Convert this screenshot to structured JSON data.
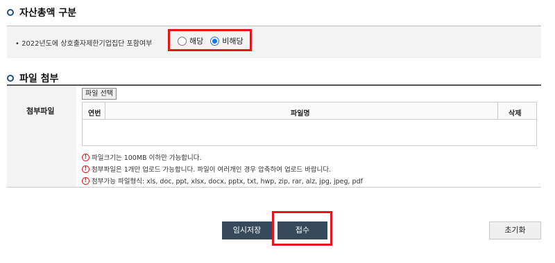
{
  "section1": {
    "title": "자산총액 구분",
    "question": "• 2022년도에 상호출자제한기업집단 포함여부",
    "options": [
      {
        "label": "해당",
        "selected": false
      },
      {
        "label": "비해당",
        "selected": true
      }
    ]
  },
  "section2": {
    "title": "파일 첨부",
    "row_label": "첨부파일",
    "file_button": "파일 선택",
    "table_headers": [
      "연번",
      "파일명",
      "삭제"
    ],
    "notes": [
      "파일크기는 100MB 이하만 가능합니다.",
      "첨부파일은 1개만 업로드 가능합니다. 파일이 여러개인 경우 압축하여 업로드 바랍니다.",
      "첨부가능 파일형식: xls, doc, ppt, xlsx, docx, pptx, txt, hwp, zip, rar, alz, jpg, jpeg, pdf"
    ],
    "warn_symbol": "!"
  },
  "buttons": {
    "temp_save": "임시저장",
    "submit": "접수",
    "reset": "초기화"
  },
  "colors": {
    "highlight": "#e8141b",
    "accent": "#1a73e8",
    "button_dark": "#364a5c"
  }
}
